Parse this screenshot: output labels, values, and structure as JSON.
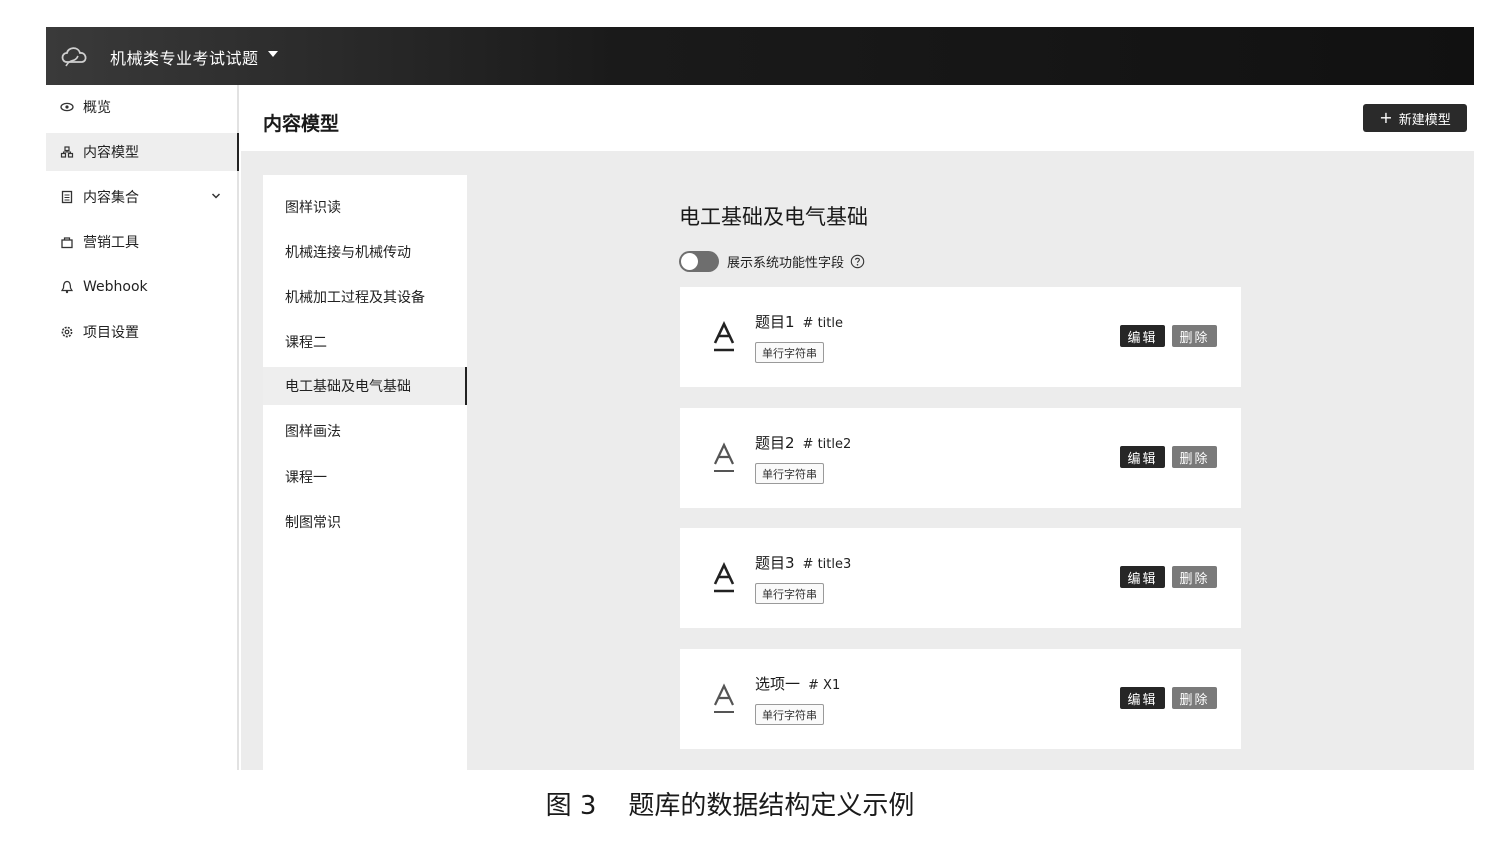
{
  "app": {
    "title": "机械类专业考试试题"
  },
  "sidebar": {
    "items": [
      {
        "label": "概览",
        "icon": "eye-icon"
      },
      {
        "label": "内容模型",
        "icon": "model-icon",
        "active": true
      },
      {
        "label": "内容集合",
        "icon": "collection-icon",
        "expandable": true
      },
      {
        "label": "营销工具",
        "icon": "bag-icon"
      },
      {
        "label": "Webhook",
        "icon": "webhook-icon"
      },
      {
        "label": "项目设置",
        "icon": "gear-icon"
      }
    ]
  },
  "header": {
    "title": "内容模型",
    "new_button": "新建模型"
  },
  "models": [
    {
      "label": "图样识读"
    },
    {
      "label": "机械连接与机械传动"
    },
    {
      "label": "机械加工过程及其设备"
    },
    {
      "label": "课程二"
    },
    {
      "label": "电工基础及电气基础",
      "active": true
    },
    {
      "label": "图样画法"
    },
    {
      "label": "课程一"
    },
    {
      "label": "制图常识"
    }
  ],
  "detail": {
    "title": "电工基础及电气基础",
    "toggle_label": "展示系统功能性字段",
    "toggle_on": false,
    "fields": [
      {
        "name": "题目1",
        "key": "# title",
        "tag": "单行字符串",
        "edit": "编辑",
        "delete": "删除"
      },
      {
        "name": "题目2",
        "key": "# title2",
        "tag": "单行字符串",
        "edit": "编辑",
        "delete": "删除"
      },
      {
        "name": "题目3",
        "key": "# title3",
        "tag": "单行字符串",
        "edit": "编辑",
        "delete": "删除"
      },
      {
        "name": "选项一",
        "key": "# X1",
        "tag": "单行字符串",
        "edit": "编辑",
        "delete": "删除"
      }
    ]
  },
  "caption": {
    "number": "图 3",
    "text": "题库的数据结构定义示例"
  }
}
